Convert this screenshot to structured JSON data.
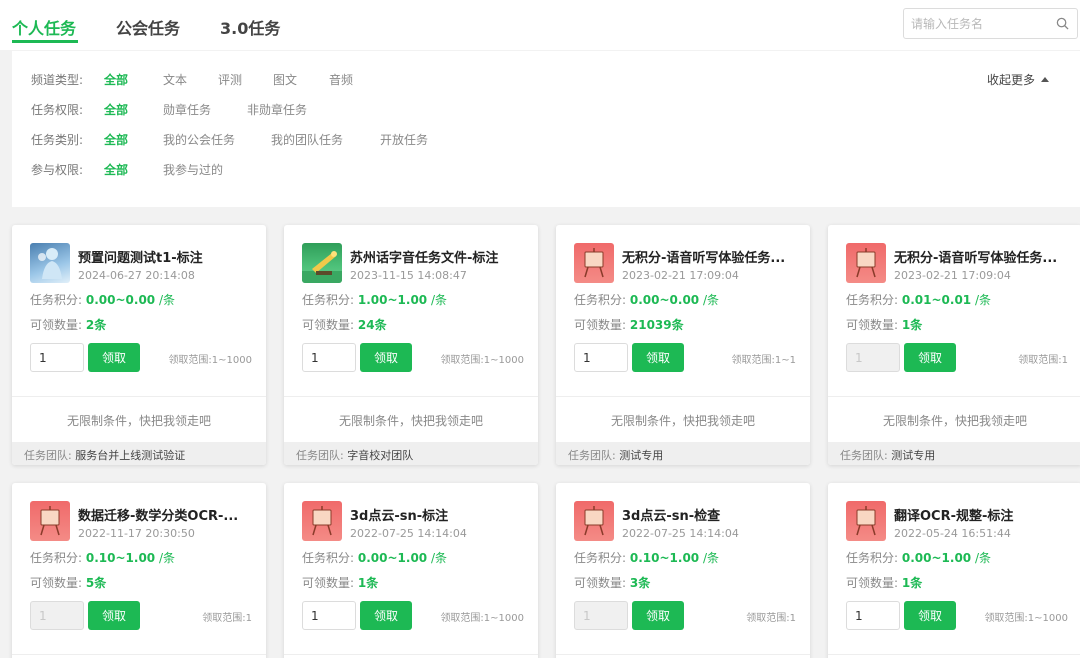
{
  "tabs": [
    {
      "label": "个人任务",
      "active": true
    },
    {
      "label": "公会任务",
      "active": false
    },
    {
      "label": "3.0任务",
      "active": false
    }
  ],
  "search": {
    "placeholder": "请输入任务名",
    "icon": "search-icon"
  },
  "colors": {
    "accent": "#1db954",
    "thumb_red": "#f06a6a",
    "thumb_green": "#2f9e59",
    "thumb_blue": "#4a7fb0"
  },
  "filters": {
    "collapse_label": "收起更多",
    "rows": [
      {
        "label": "频道类型:",
        "options": [
          "全部",
          "文本",
          "评测",
          "图文",
          "音频"
        ],
        "active_index": 0
      },
      {
        "label": "任务权限:",
        "options": [
          "全部",
          "勋章任务",
          "非勋章任务"
        ],
        "active_index": 0
      },
      {
        "label": "任务类别:",
        "options": [
          "全部",
          "我的公会任务",
          "我的团队任务",
          "开放任务"
        ],
        "active_index": 0
      },
      {
        "label": "参与权限:",
        "options": [
          "全部",
          "我参与过的"
        ],
        "active_index": 0
      }
    ]
  },
  "labels": {
    "points": "任务积分:",
    "count": "可领数量:",
    "claim": "领取",
    "no_condition": "无限制条件，快把我领走吧",
    "team": "任务团队:",
    "per": "/条",
    "unit": "条"
  },
  "cards": [
    {
      "title": "预置问题测试t1-标注",
      "date": "2024-06-27 20:14:08",
      "points": "0.00~0.00",
      "count": "2",
      "qty": "1",
      "qty_disabled": false,
      "range": "领取范围:1~1000",
      "team": "服务台并上线测试验证",
      "thumb": "blue"
    },
    {
      "title": "苏州话字音任务文件-标注",
      "date": "2023-11-15 14:08:47",
      "points": "1.00~1.00",
      "count": "24",
      "qty": "1",
      "qty_disabled": false,
      "range": "领取范围:1~1000",
      "team": "字音校对团队",
      "thumb": "green"
    },
    {
      "title": "无积分-语音听写体验任务...",
      "date": "2023-02-21 17:09:04",
      "points": "0.00~0.00",
      "count": "21039",
      "qty": "1",
      "qty_disabled": false,
      "range": "领取范围:1~1",
      "team": "测试专用",
      "thumb": "red"
    },
    {
      "title": "无积分-语音听写体验任务...",
      "date": "2023-02-21 17:09:04",
      "points": "0.01~0.01",
      "count": "1",
      "qty": "1",
      "qty_disabled": true,
      "range": "领取范围:1",
      "team": "测试专用",
      "thumb": "red"
    },
    {
      "title": "数据迁移-数学分类OCR-...",
      "date": "2022-11-17 20:30:50",
      "points": "0.10~1.00",
      "count": "5",
      "qty": "1",
      "qty_disabled": true,
      "range": "领取范围:1",
      "team": "",
      "thumb": "red"
    },
    {
      "title": "3d点云-sn-标注",
      "date": "2022-07-25 14:14:04",
      "points": "0.00~1.00",
      "count": "1",
      "qty": "1",
      "qty_disabled": false,
      "range": "领取范围:1~1000",
      "team": "",
      "thumb": "red"
    },
    {
      "title": "3d点云-sn-检查",
      "date": "2022-07-25 14:14:04",
      "points": "0.10~1.00",
      "count": "3",
      "qty": "1",
      "qty_disabled": true,
      "range": "领取范围:1",
      "team": "",
      "thumb": "red"
    },
    {
      "title": "翻译OCR-规整-标注",
      "date": "2022-05-24 16:51:44",
      "points": "0.00~1.00",
      "count": "1",
      "qty": "1",
      "qty_disabled": false,
      "range": "领取范围:1~1000",
      "team": "",
      "thumb": "red"
    }
  ]
}
